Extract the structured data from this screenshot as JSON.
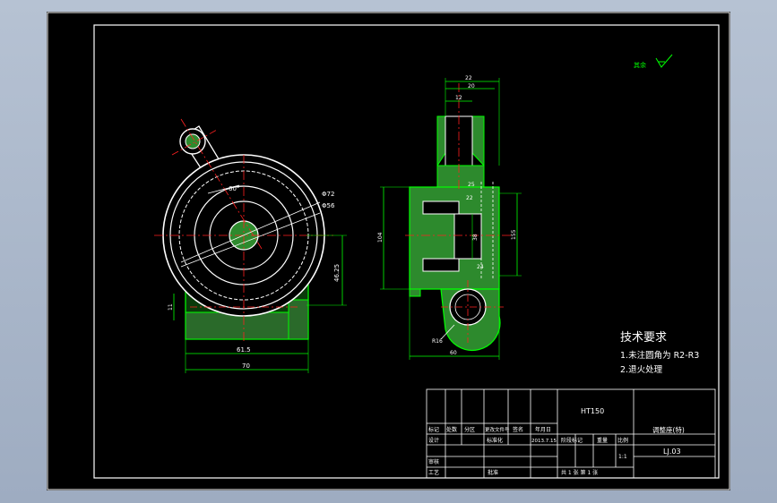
{
  "drawing": {
    "roughness_note": "其余",
    "tech_requirements": {
      "title": "技术要求",
      "item1": "1.未注圆角为 R2-R3",
      "item2": "2.退火处理"
    },
    "front_dims": {
      "d72": "Φ72",
      "d56": "Φ56",
      "angle": "60°",
      "h4625": "46.25",
      "h11": "11",
      "w615": "61.5",
      "w70": "70"
    },
    "side_dims": {
      "top22": "22",
      "top20": "20",
      "top12": "12",
      "d25": "25",
      "d22": "22",
      "left104": "104",
      "mid38": "38",
      "right155": "155",
      "mid24": "24",
      "bot60": "60",
      "r165": "R16"
    },
    "title_block": {
      "material": "HT150",
      "part_name": "调整座(特)",
      "drawing_no": "LJ.03",
      "col_biaoji": "标记",
      "col_chushu": "处数",
      "col_fenqu": "分区",
      "col_gengai": "更改文件号",
      "col_qianming": "签名",
      "col_riqi": "年月日",
      "row_sheji": "设计",
      "row_shenhe": "审核",
      "row_gongyi": "工艺",
      "row_pizhun": "批准",
      "std": "标准化",
      "date": "2013.7.15",
      "stage": "阶段标记",
      "weight": "重量",
      "scale": "比例",
      "scale_val": "1:1",
      "sheets": "共  1  张  第  1  张"
    }
  }
}
